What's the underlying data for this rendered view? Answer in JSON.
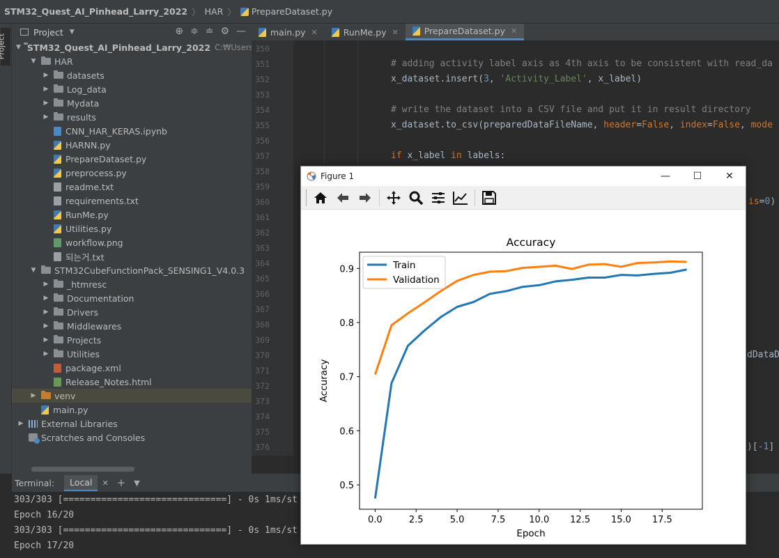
{
  "breadcrumb": {
    "project": "STM32_Quest_AI_Pinhead_Larry_2022",
    "folder": "HAR",
    "file": "PrepareDataset.py"
  },
  "side_tab": "Project",
  "project_panel": {
    "title": "Project"
  },
  "tree": [
    {
      "label": "STM32_Quest_AI_Pinhead_Larry_2022",
      "extra": "C:₩Users₩이동",
      "bold": true
    },
    {
      "label": "HAR"
    },
    {
      "label": "datasets"
    },
    {
      "label": "Log_data"
    },
    {
      "label": "Mydata"
    },
    {
      "label": "results"
    },
    {
      "label": "CNN_HAR_KERAS.ipynb"
    },
    {
      "label": "HARNN.py"
    },
    {
      "label": "PrepareDataset.py"
    },
    {
      "label": "preprocess.py"
    },
    {
      "label": "readme.txt"
    },
    {
      "label": "requirements.txt"
    },
    {
      "label": "RunMe.py"
    },
    {
      "label": "Utilities.py"
    },
    {
      "label": "workflow.png"
    },
    {
      "label": "되는거.txt"
    },
    {
      "label": "STM32CubeFunctionPack_SENSING1_V4.0.3"
    },
    {
      "label": "_htmresc"
    },
    {
      "label": "Documentation"
    },
    {
      "label": "Drivers"
    },
    {
      "label": "Middlewares"
    },
    {
      "label": "Projects"
    },
    {
      "label": "Utilities"
    },
    {
      "label": "package.xml"
    },
    {
      "label": "Release_Notes.html"
    },
    {
      "label": "venv"
    },
    {
      "label": "main.py"
    },
    {
      "label": "External Libraries"
    },
    {
      "label": "Scratches and Consoles"
    }
  ],
  "tabs": [
    {
      "label": "main.py"
    },
    {
      "label": "RunMe.py"
    },
    {
      "label": "PrepareDataset.py",
      "active": true
    }
  ],
  "line_numbers": [
    "350",
    "351",
    "352",
    "353",
    "354",
    "355",
    "356",
    "357",
    "358",
    "359",
    "360",
    "361",
    "362",
    "363",
    "364",
    "365",
    "366",
    "367",
    "368",
    "369",
    "370",
    "371",
    "372",
    "373",
    "374",
    "375",
    "376"
  ],
  "code": {
    "l351": "# adding activity label axis as 4th axis to be consistent with read_da",
    "l352_a": "x_dataset.insert(",
    "l352_b": "3",
    "l352_c": ", ",
    "l352_d": "'Activity_Label'",
    "l352_e": ", x_label)",
    "l354": "# write the dataset into a CSV file and put it in result directory",
    "l355_a": "x_dataset.to_csv(preparedDataFileName, ",
    "l355_b": "header",
    "l355_c": "=",
    "l355_d": "False",
    "l355_e": ", ",
    "l355_f": "index",
    "l355_g": "=",
    "l355_h": "False",
    "l355_i": ", ",
    "l355_j": "mode",
    "l357_a": "if",
    "l357_b": " x_label ",
    "l357_c": "in",
    "l357_d": " labels:",
    "side360_a": "is",
    "side360_b": "=",
    "side360_c": "0",
    "side360_d": ")",
    "side370": "dDataD",
    "side376_a": ")[",
    "side376_b": "-1",
    "side376_c": "]"
  },
  "terminal": {
    "label": "Terminal:",
    "tab": "Local",
    "lines": [
      "303/303 [==============================] - 0s 1ms/st",
      "Epoch 16/20",
      "303/303 [==============================] - 0s 1ms/st",
      "Epoch 17/20"
    ]
  },
  "figure": {
    "title": "Figure 1"
  },
  "chart_data": {
    "type": "line",
    "title": "Accuracy",
    "xlabel": "Epoch",
    "ylabel": "Accuracy",
    "xlim": [
      -0.95,
      19.95
    ],
    "ylim": [
      0.455,
      0.93
    ],
    "xticks": [
      0.0,
      2.5,
      5.0,
      7.5,
      10.0,
      12.5,
      15.0,
      17.5
    ],
    "xtick_labels": [
      "0.0",
      "2.5",
      "5.0",
      "7.5",
      "10.0",
      "12.5",
      "15.0",
      "17.5"
    ],
    "yticks": [
      0.5,
      0.6,
      0.7,
      0.8,
      0.9
    ],
    "ytick_labels": [
      "0.5",
      "0.6",
      "0.7",
      "0.8",
      "0.9"
    ],
    "legend": "upper-left",
    "grid": false,
    "x": [
      0,
      1,
      2,
      3,
      4,
      5,
      6,
      7,
      8,
      9,
      10,
      11,
      12,
      13,
      14,
      15,
      16,
      17,
      18,
      19
    ],
    "series": [
      {
        "name": "Train",
        "color": "#1f77b4",
        "values": [
          0.475,
          0.688,
          0.757,
          0.785,
          0.81,
          0.829,
          0.838,
          0.853,
          0.858,
          0.866,
          0.869,
          0.876,
          0.879,
          0.883,
          0.883,
          0.888,
          0.887,
          0.89,
          0.892,
          0.898
        ]
      },
      {
        "name": "Validation",
        "color": "#ff7f0e",
        "values": [
          0.704,
          0.795,
          0.817,
          0.837,
          0.858,
          0.877,
          0.888,
          0.894,
          0.895,
          0.901,
          0.903,
          0.905,
          0.899,
          0.907,
          0.908,
          0.903,
          0.91,
          0.911,
          0.913,
          0.912
        ]
      }
    ]
  }
}
